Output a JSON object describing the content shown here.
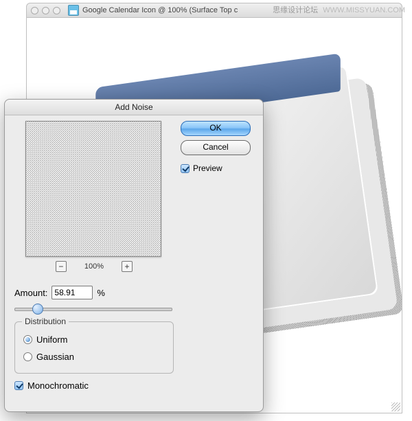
{
  "watermark": {
    "cn": "思缘设计论坛",
    "url": "WWW.MISSYUAN.COM"
  },
  "doc_window": {
    "title": "Google Calendar Icon @ 100% (Surface Top c"
  },
  "dialog": {
    "title": "Add Noise",
    "ok_label": "OK",
    "cancel_label": "Cancel",
    "preview_label": "Preview",
    "preview_checked": true,
    "zoom_text": "100%",
    "zoom_out": "−",
    "zoom_in": "+",
    "amount_label": "Amount:",
    "amount_value": "58.91",
    "amount_suffix": "%",
    "slider_min": 0,
    "slider_max": 400,
    "distribution": {
      "legend": "Distribution",
      "uniform_label": "Uniform",
      "gaussian_label": "Gaussian",
      "selected": "uniform"
    },
    "monochrome_label": "Monochromatic",
    "monochrome_checked": true
  }
}
